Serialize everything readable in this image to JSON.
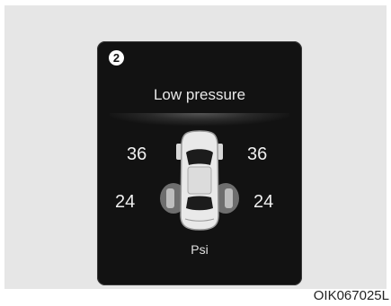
{
  "display": {
    "badge": "2",
    "warning_text": "Low pressure",
    "tires": {
      "front_left": "36",
      "front_right": "36",
      "rear_left": "24",
      "rear_right": "24"
    },
    "unit": "Psi",
    "icons": [
      "car-top-view-icon",
      "tire-front-left-icon",
      "tire-front-right-icon",
      "tire-rear-left-low-icon",
      "tire-rear-right-low-icon"
    ],
    "colors": {
      "panel": "#121212",
      "text": "#e8e8e8",
      "low_tire_highlight": "#8a8a8a"
    }
  },
  "caption": "OIK067025L"
}
